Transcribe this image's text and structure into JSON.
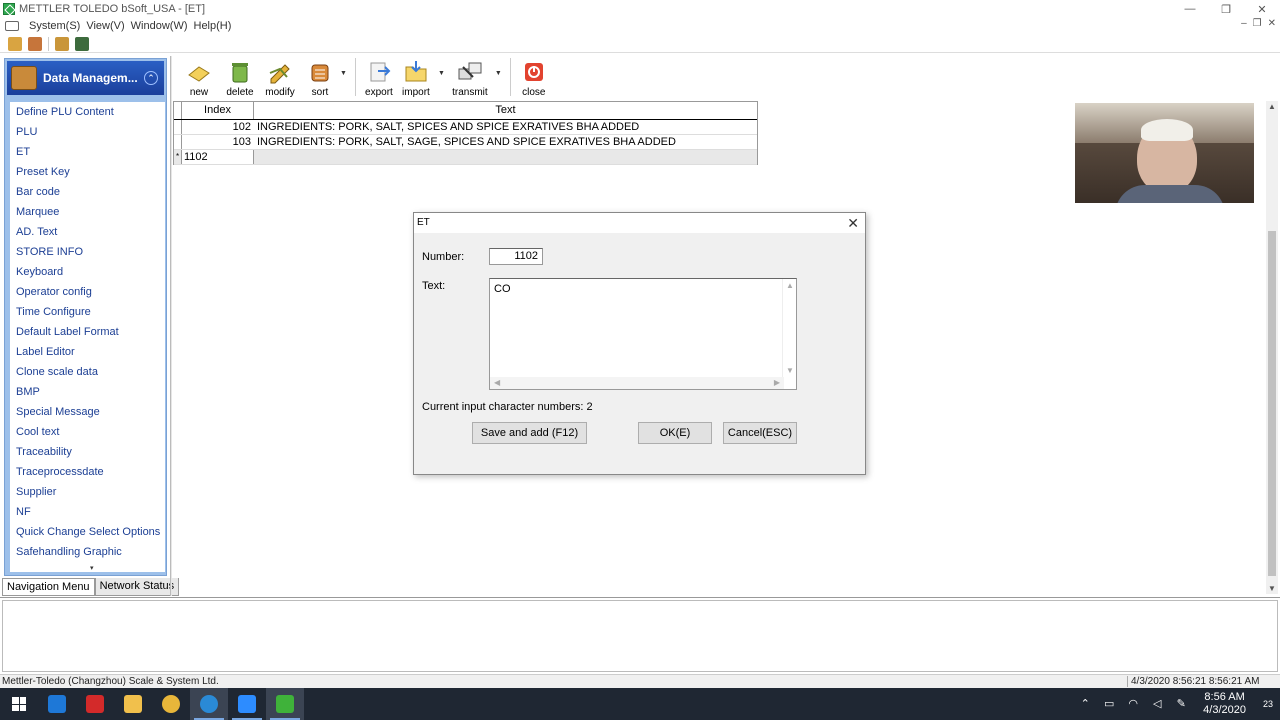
{
  "window": {
    "title": "METTLER TOLEDO bSoft_USA - [ET]",
    "controls": {
      "minimize": "—",
      "maximize": "❐",
      "close": "✕"
    }
  },
  "menubar": {
    "items": [
      "System(S)",
      "View(V)",
      "Window(W)",
      "Help(H)"
    ],
    "mdi_controls": [
      "–",
      "❐",
      "✕"
    ]
  },
  "left_panel": {
    "title": "Data Managem...",
    "collapse_glyph": "⌃",
    "items": [
      "Define PLU Content",
      "PLU",
      "ET",
      "Preset Key",
      "Bar code",
      "Marquee",
      "AD. Text",
      "STORE INFO",
      "Keyboard",
      "Operator config",
      "Time Configure",
      "Default Label Format",
      "Label Editor",
      "Clone scale data",
      "BMP",
      "Special Message",
      "Cool text",
      "Traceability",
      "Traceprocessdate",
      "Supplier",
      "NF",
      "Quick Change Select Options",
      "Safehandling Graphic"
    ],
    "tabs": [
      "Navigation Menu",
      "Network Status"
    ]
  },
  "toolbar": {
    "new": "new",
    "delete": "delete",
    "modify": "modify",
    "sort": "sort",
    "export": "export",
    "import": "import",
    "transmit": "transmit",
    "close": "close",
    "dropdown_glyph": "▼"
  },
  "grid": {
    "headers": {
      "index": "Index",
      "text": "Text"
    },
    "rows": [
      {
        "index": "102",
        "text": "INGREDIENTS: PORK, SALT, SPICES AND SPICE EXRATIVES BHA ADDED"
      },
      {
        "index": "103",
        "text": "INGREDIENTS: PORK, SALT, SAGE, SPICES AND SPICE EXRATIVES BHA ADDED"
      }
    ],
    "new_row": {
      "marker": "*",
      "index": "1102"
    }
  },
  "dialog": {
    "title": "ET",
    "close_glyph": "✕",
    "number_label": "Number:",
    "number_value": "1102",
    "text_label": "Text:",
    "text_value": "CO",
    "char_count": "Current input character numbers: 2",
    "buttons": {
      "save_add": "Save and add (F12)",
      "ok": "OK(E)",
      "cancel": "Cancel(ESC)"
    }
  },
  "statusbar": {
    "company": "Mettler-Toledo (Changzhou) Scale & System Ltd.",
    "datetime": "4/3/2020 8:56:21 8:56:21 AM"
  },
  "taskbar": {
    "time": "8:56 AM",
    "date": "4/3/2020",
    "notification_count": "23"
  },
  "colors": {
    "panel_blue": "#9dc0ea",
    "header_blue": "#1b3f9b",
    "nav_text": "#1c3f94",
    "taskbar": "#1f2733"
  }
}
